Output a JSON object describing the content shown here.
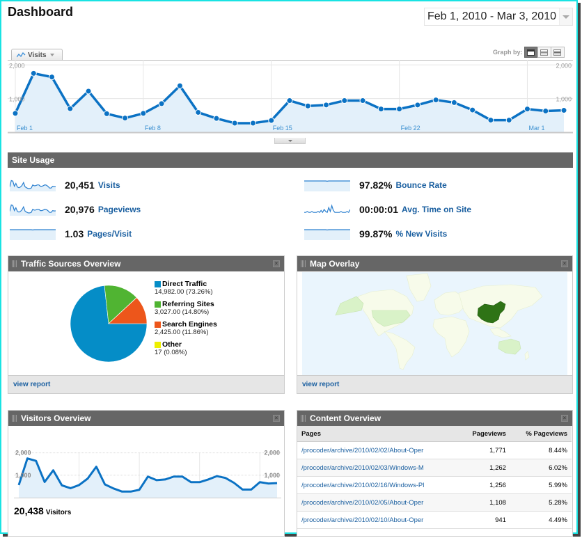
{
  "header": {
    "title": "Dashboard",
    "date_range": "Feb 1, 2010 - Mar 3, 2010"
  },
  "main_chart": {
    "metric_selector": "Visits",
    "graph_by_label": "Graph by:",
    "graph_by_options": [
      "day",
      "week",
      "month"
    ],
    "graph_by_selected": "day"
  },
  "chart_data": [
    {
      "type": "area",
      "title": "Visits",
      "x": [
        "Feb 1",
        "Feb 2",
        "Feb 3",
        "Feb 4",
        "Feb 5",
        "Feb 6",
        "Feb 7",
        "Feb 8",
        "Feb 9",
        "Feb 10",
        "Feb 11",
        "Feb 12",
        "Feb 13",
        "Feb 14",
        "Feb 15",
        "Feb 16",
        "Feb 17",
        "Feb 18",
        "Feb 19",
        "Feb 20",
        "Feb 21",
        "Feb 22",
        "Feb 23",
        "Feb 24",
        "Feb 25",
        "Feb 26",
        "Feb 27",
        "Feb 28",
        "Mar 1",
        "Mar 2",
        "Mar 3"
      ],
      "values": [
        560,
        1750,
        1640,
        700,
        1220,
        550,
        420,
        560,
        850,
        1380,
        590,
        410,
        270,
        270,
        350,
        940,
        780,
        810,
        940,
        940,
        690,
        690,
        810,
        960,
        880,
        660,
        360,
        360,
        690,
        630,
        650
      ],
      "xticks": [
        "Feb 1",
        "Feb 8",
        "Feb 15",
        "Feb 22",
        "Mar 1"
      ],
      "yticks_left": [
        "2,000",
        "1,000"
      ],
      "yticks_right": [
        "2,000",
        "1,000"
      ],
      "ylim": [
        0,
        2150
      ],
      "grid": true,
      "color": "#0b72c4",
      "fill": "#e3f0fa"
    },
    {
      "type": "pie",
      "title": "Traffic Sources Overview",
      "slices": [
        {
          "name": "Direct Traffic",
          "value": 14982.0,
          "value_label": "14,982.00",
          "percent": "73.26%",
          "color": "#058dc7"
        },
        {
          "name": "Referring Sites",
          "value": 3027.0,
          "value_label": "3,027.00",
          "percent": "14.80%",
          "color": "#50b432"
        },
        {
          "name": "Search Engines",
          "value": 2425.0,
          "value_label": "2,425.00",
          "percent": "11.86%",
          "color": "#ed561b"
        },
        {
          "name": "Other",
          "value": 17,
          "value_label": "17",
          "percent": "0.08%",
          "color": "#edef00"
        }
      ],
      "legend": "right"
    },
    {
      "type": "area",
      "title": "Visitors Overview",
      "values": [
        560,
        1750,
        1640,
        700,
        1220,
        550,
        420,
        560,
        850,
        1380,
        590,
        410,
        270,
        270,
        350,
        940,
        780,
        810,
        940,
        940,
        690,
        690,
        810,
        960,
        880,
        660,
        360,
        360,
        690,
        630,
        650
      ],
      "yticks_left": [
        "2,000",
        "1,000"
      ],
      "yticks_right": [
        "2,000",
        "1,000"
      ],
      "ylim": [
        0,
        2000
      ],
      "grid": true,
      "color": "#0b72c4",
      "fill": "#e3f0fa"
    }
  ],
  "site_usage": {
    "title": "Site Usage",
    "metrics": [
      {
        "value": "20,451",
        "label": "Visits",
        "spark": "wavy"
      },
      {
        "value": "20,976",
        "label": "Pageviews",
        "spark": "wavy"
      },
      {
        "value": "1.03",
        "label": "Pages/Visit",
        "spark": "flat"
      },
      {
        "value": "97.82%",
        "label": "Bounce Rate",
        "spark": "flat"
      },
      {
        "value": "00:00:01",
        "label": "Avg. Time on Site",
        "spark": "spiky"
      },
      {
        "value": "99.87%",
        "label": "% New Visits",
        "spark": "flat"
      }
    ]
  },
  "traffic_sources": {
    "title": "Traffic Sources Overview",
    "footer_link": "view report"
  },
  "map_overlay": {
    "title": "Map Overlay",
    "footer_link": "view report",
    "highlighted_country": "China",
    "colors": {
      "ocean": "#eaf5fd",
      "land": "#f7fbea",
      "light": "#d9f2c8",
      "dark": "#2e7316"
    }
  },
  "visitors_overview": {
    "title": "Visitors Overview",
    "total": "20,438",
    "total_label": "Visitors"
  },
  "content_overview": {
    "title": "Content Overview",
    "columns": [
      "Pages",
      "Pageviews",
      "% Pageviews"
    ],
    "rows": [
      {
        "page": "/procoder/archive/2010/02/02/About-Oper",
        "pageviews": "1,771",
        "percent": "8.44%"
      },
      {
        "page": "/procoder/archive/2010/02/03/Windows-M",
        "pageviews": "1,262",
        "percent": "6.02%"
      },
      {
        "page": "/procoder/archive/2010/02/16/Windows-Pl",
        "pageviews": "1,256",
        "percent": "5.99%"
      },
      {
        "page": "/procoder/archive/2010/02/05/About-Oper",
        "pageviews": "1,108",
        "percent": "5.28%"
      },
      {
        "page": "/procoder/archive/2010/02/10/About-Oper",
        "pageviews": "941",
        "percent": "4.49%"
      }
    ]
  }
}
